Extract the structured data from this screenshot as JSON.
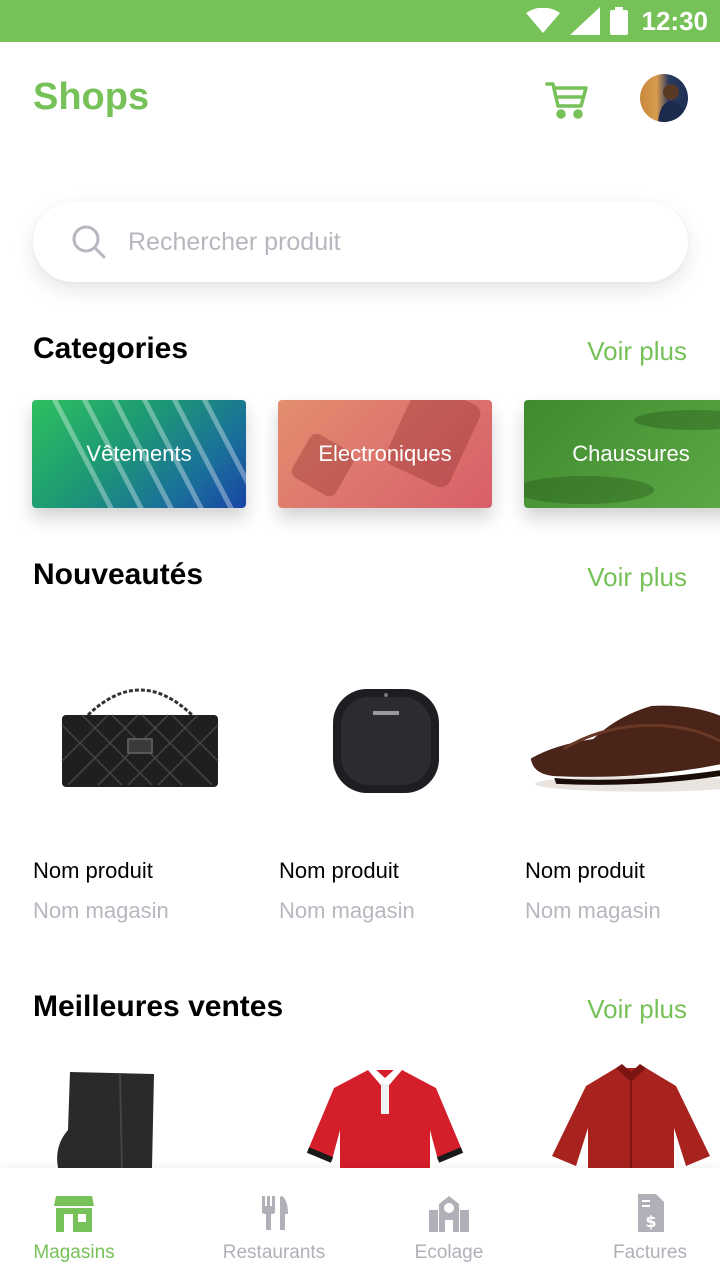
{
  "status_bar": {
    "time": "12:30"
  },
  "header": {
    "title": "Shops"
  },
  "search": {
    "placeholder": "Rechercher produit"
  },
  "sections": {
    "categories": {
      "title": "Categories",
      "see_more": "Voir plus"
    },
    "new_arrivals": {
      "title": "Nouveautés",
      "see_more": "Voir plus"
    },
    "best_sellers": {
      "title": "Meilleures ventes",
      "see_more": "Voir plus"
    }
  },
  "categories": [
    {
      "label": "Vêtements"
    },
    {
      "label": "Electroniques"
    },
    {
      "label": "Chaussures"
    }
  ],
  "new_arrivals": [
    {
      "name": "Nom produit",
      "store": "Nom magasin",
      "image": "handbag"
    },
    {
      "name": "Nom produit",
      "store": "Nom magasin",
      "image": "speaker"
    },
    {
      "name": "Nom produit",
      "store": "Nom magasin",
      "image": "shoes"
    }
  ],
  "best_sellers": [
    {
      "image": "boot"
    },
    {
      "image": "red-polo-shirt"
    },
    {
      "image": "red-shirt"
    }
  ],
  "bottom_nav": [
    {
      "label": "Magasins",
      "icon": "store-icon",
      "active": true
    },
    {
      "label": "Restaurants",
      "icon": "fork-knife-icon",
      "active": false
    },
    {
      "label": "Ecolage",
      "icon": "school-icon",
      "active": false
    },
    {
      "label": "Factures",
      "icon": "invoice-icon",
      "active": false
    }
  ],
  "colors": {
    "accent": "#76c158",
    "muted": "#b7b7bf"
  }
}
